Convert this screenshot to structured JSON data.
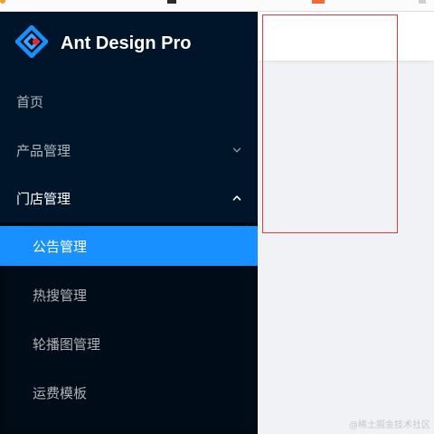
{
  "app": {
    "title": "Ant Design Pro",
    "logo_icon": "ant-design-diamond-icon",
    "brand_colors": {
      "sider_bg": "#001529",
      "submenu_bg": "#000c17",
      "selected_bg": "#1890ff",
      "logo_blue": "#1890ff",
      "logo_red": "#f5222d"
    }
  },
  "sidebar": {
    "items": [
      {
        "label": "首页",
        "level": 1
      },
      {
        "label": "产品管理",
        "level": 1,
        "expandable": true,
        "expanded": false,
        "icon": "chevron-down-icon"
      },
      {
        "label": "门店管理",
        "level": 1,
        "expandable": true,
        "expanded": true,
        "icon": "chevron-up-icon"
      },
      {
        "label": "公告管理",
        "level": 2,
        "selected": true
      },
      {
        "label": "热搜管理",
        "level": 2
      },
      {
        "label": "轮播图管理",
        "level": 2
      },
      {
        "label": "运费模板",
        "level": 2
      }
    ]
  },
  "content": {
    "outline_color": "#e23b3b"
  },
  "watermark": "@稀土掘金技术社区"
}
